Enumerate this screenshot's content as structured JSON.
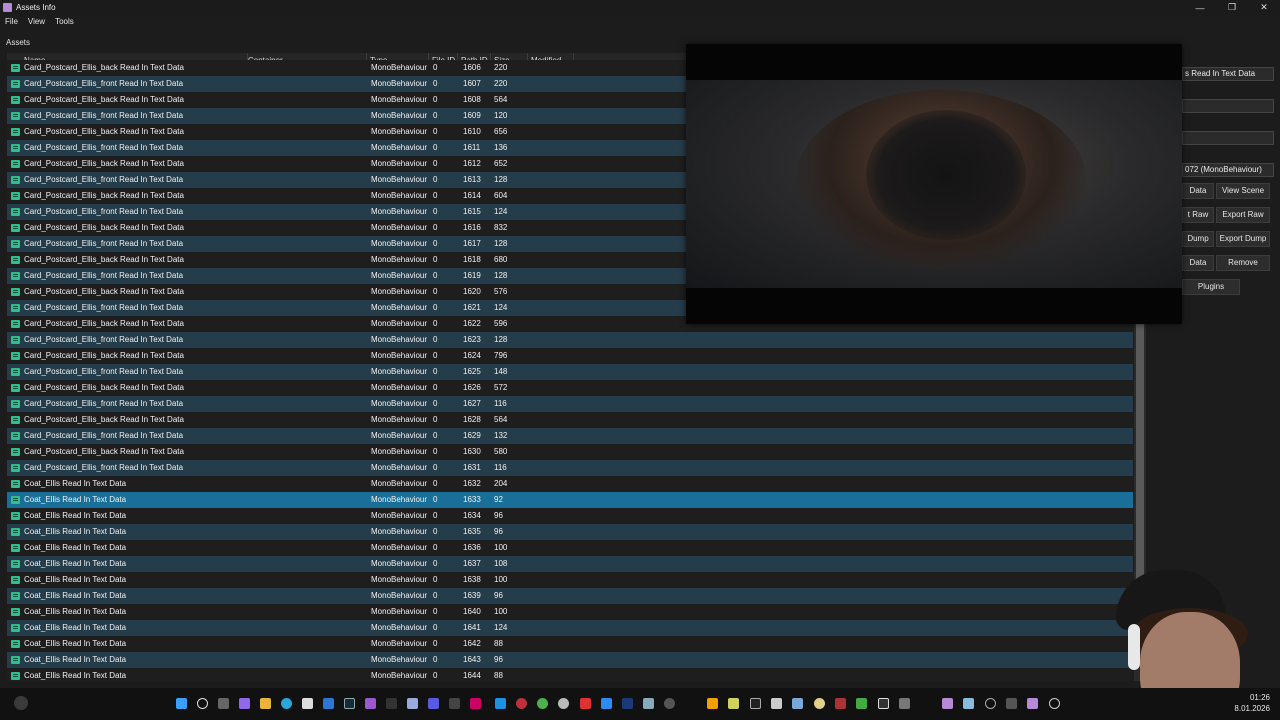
{
  "window": {
    "title": "Assets Info",
    "controls": {
      "minimize": "—",
      "maximize": "❐",
      "close": "✕"
    }
  },
  "menu": [
    "File",
    "View",
    "Tools"
  ],
  "section_label": "Assets",
  "table": {
    "columns": [
      "Name",
      "Container",
      "Type",
      "File ID",
      "Path ID",
      "Size",
      "Modified"
    ],
    "selected_path_id": "1633",
    "rows": [
      {
        "name": "Card_Postcard_Ellis_back Read In Text Data",
        "type": "MonoBehaviour",
        "file_id": "0",
        "path_id": "1606",
        "size": "220"
      },
      {
        "name": "Card_Postcard_Ellis_front Read In Text Data",
        "type": "MonoBehaviour",
        "file_id": "0",
        "path_id": "1607",
        "size": "220"
      },
      {
        "name": "Card_Postcard_Ellis_back Read In Text Data",
        "type": "MonoBehaviour",
        "file_id": "0",
        "path_id": "1608",
        "size": "564"
      },
      {
        "name": "Card_Postcard_Ellis_front Read In Text Data",
        "type": "MonoBehaviour",
        "file_id": "0",
        "path_id": "1609",
        "size": "120"
      },
      {
        "name": "Card_Postcard_Ellis_back Read In Text Data",
        "type": "MonoBehaviour",
        "file_id": "0",
        "path_id": "1610",
        "size": "656"
      },
      {
        "name": "Card_Postcard_Ellis_front Read In Text Data",
        "type": "MonoBehaviour",
        "file_id": "0",
        "path_id": "1611",
        "size": "136"
      },
      {
        "name": "Card_Postcard_Ellis_back Read In Text Data",
        "type": "MonoBehaviour",
        "file_id": "0",
        "path_id": "1612",
        "size": "652"
      },
      {
        "name": "Card_Postcard_Ellis_front Read In Text Data",
        "type": "MonoBehaviour",
        "file_id": "0",
        "path_id": "1613",
        "size": "128"
      },
      {
        "name": "Card_Postcard_Ellis_back Read In Text Data",
        "type": "MonoBehaviour",
        "file_id": "0",
        "path_id": "1614",
        "size": "604"
      },
      {
        "name": "Card_Postcard_Ellis_front Read In Text Data",
        "type": "MonoBehaviour",
        "file_id": "0",
        "path_id": "1615",
        "size": "124"
      },
      {
        "name": "Card_Postcard_Ellis_back Read In Text Data",
        "type": "MonoBehaviour",
        "file_id": "0",
        "path_id": "1616",
        "size": "832"
      },
      {
        "name": "Card_Postcard_Ellis_front Read In Text Data",
        "type": "MonoBehaviour",
        "file_id": "0",
        "path_id": "1617",
        "size": "128"
      },
      {
        "name": "Card_Postcard_Ellis_back Read In Text Data",
        "type": "MonoBehaviour",
        "file_id": "0",
        "path_id": "1618",
        "size": "680"
      },
      {
        "name": "Card_Postcard_Ellis_front Read In Text Data",
        "type": "MonoBehaviour",
        "file_id": "0",
        "path_id": "1619",
        "size": "128"
      },
      {
        "name": "Card_Postcard_Ellis_back Read In Text Data",
        "type": "MonoBehaviour",
        "file_id": "0",
        "path_id": "1620",
        "size": "576"
      },
      {
        "name": "Card_Postcard_Ellis_front Read In Text Data",
        "type": "MonoBehaviour",
        "file_id": "0",
        "path_id": "1621",
        "size": "124"
      },
      {
        "name": "Card_Postcard_Ellis_back Read In Text Data",
        "type": "MonoBehaviour",
        "file_id": "0",
        "path_id": "1622",
        "size": "596"
      },
      {
        "name": "Card_Postcard_Ellis_front Read In Text Data",
        "type": "MonoBehaviour",
        "file_id": "0",
        "path_id": "1623",
        "size": "128"
      },
      {
        "name": "Card_Postcard_Ellis_back Read In Text Data",
        "type": "MonoBehaviour",
        "file_id": "0",
        "path_id": "1624",
        "size": "796"
      },
      {
        "name": "Card_Postcard_Ellis_front Read In Text Data",
        "type": "MonoBehaviour",
        "file_id": "0",
        "path_id": "1625",
        "size": "148"
      },
      {
        "name": "Card_Postcard_Ellis_back Read In Text Data",
        "type": "MonoBehaviour",
        "file_id": "0",
        "path_id": "1626",
        "size": "572"
      },
      {
        "name": "Card_Postcard_Ellis_front Read In Text Data",
        "type": "MonoBehaviour",
        "file_id": "0",
        "path_id": "1627",
        "size": "116"
      },
      {
        "name": "Card_Postcard_Ellis_back Read In Text Data",
        "type": "MonoBehaviour",
        "file_id": "0",
        "path_id": "1628",
        "size": "564"
      },
      {
        "name": "Card_Postcard_Ellis_front Read In Text Data",
        "type": "MonoBehaviour",
        "file_id": "0",
        "path_id": "1629",
        "size": "132"
      },
      {
        "name": "Card_Postcard_Ellis_back Read In Text Data",
        "type": "MonoBehaviour",
        "file_id": "0",
        "path_id": "1630",
        "size": "580"
      },
      {
        "name": "Card_Postcard_Ellis_front Read In Text Data",
        "type": "MonoBehaviour",
        "file_id": "0",
        "path_id": "1631",
        "size": "116"
      },
      {
        "name": "Coat_Ellis Read In Text Data",
        "type": "MonoBehaviour",
        "file_id": "0",
        "path_id": "1632",
        "size": "204"
      },
      {
        "name": "Coat_Ellis Read In Text Data",
        "type": "MonoBehaviour",
        "file_id": "0",
        "path_id": "1633",
        "size": "92"
      },
      {
        "name": "Coat_Ellis Read In Text Data",
        "type": "MonoBehaviour",
        "file_id": "0",
        "path_id": "1634",
        "size": "96"
      },
      {
        "name": "Coat_Ellis Read In Text Data",
        "type": "MonoBehaviour",
        "file_id": "0",
        "path_id": "1635",
        "size": "96"
      },
      {
        "name": "Coat_Ellis Read In Text Data",
        "type": "MonoBehaviour",
        "file_id": "0",
        "path_id": "1636",
        "size": "100"
      },
      {
        "name": "Coat_Ellis Read In Text Data",
        "type": "MonoBehaviour",
        "file_id": "0",
        "path_id": "1637",
        "size": "108"
      },
      {
        "name": "Coat_Ellis Read In Text Data",
        "type": "MonoBehaviour",
        "file_id": "0",
        "path_id": "1638",
        "size": "100"
      },
      {
        "name": "Coat_Ellis Read In Text Data",
        "type": "MonoBehaviour",
        "file_id": "0",
        "path_id": "1639",
        "size": "96"
      },
      {
        "name": "Coat_Ellis Read In Text Data",
        "type": "MonoBehaviour",
        "file_id": "0",
        "path_id": "1640",
        "size": "100"
      },
      {
        "name": "Coat_Ellis Read In Text Data",
        "type": "MonoBehaviour",
        "file_id": "0",
        "path_id": "1641",
        "size": "124"
      },
      {
        "name": "Coat_Ellis Read In Text Data",
        "type": "MonoBehaviour",
        "file_id": "0",
        "path_id": "1642",
        "size": "88"
      },
      {
        "name": "Coat_Ellis Read In Text Data",
        "type": "MonoBehaviour",
        "file_id": "0",
        "path_id": "1643",
        "size": "96"
      },
      {
        "name": "Coat_Ellis Read In Text Data",
        "type": "MonoBehaviour",
        "file_id": "0",
        "path_id": "1644",
        "size": "88"
      }
    ]
  },
  "side_panel": {
    "name_field": "s Read In Text Data",
    "field2": "",
    "field3": "",
    "type_field": "072 (MonoBehaviour)",
    "buttons": {
      "view_data": "Data",
      "view_scene": "View Scene",
      "export_raw_left": "t Raw",
      "export_raw": "Export Raw",
      "dump_left": "Dump",
      "export_dump": "Export Dump",
      "data_left": "Data",
      "remove": "Remove",
      "plugins": "Plugins"
    }
  },
  "taskbar": {
    "time": "01:26",
    "date": "8.01.2026"
  },
  "colors": {
    "row_alt": "#253c4a",
    "row_selected": "#1a6f98",
    "row_icon": "#2dbf8d"
  }
}
